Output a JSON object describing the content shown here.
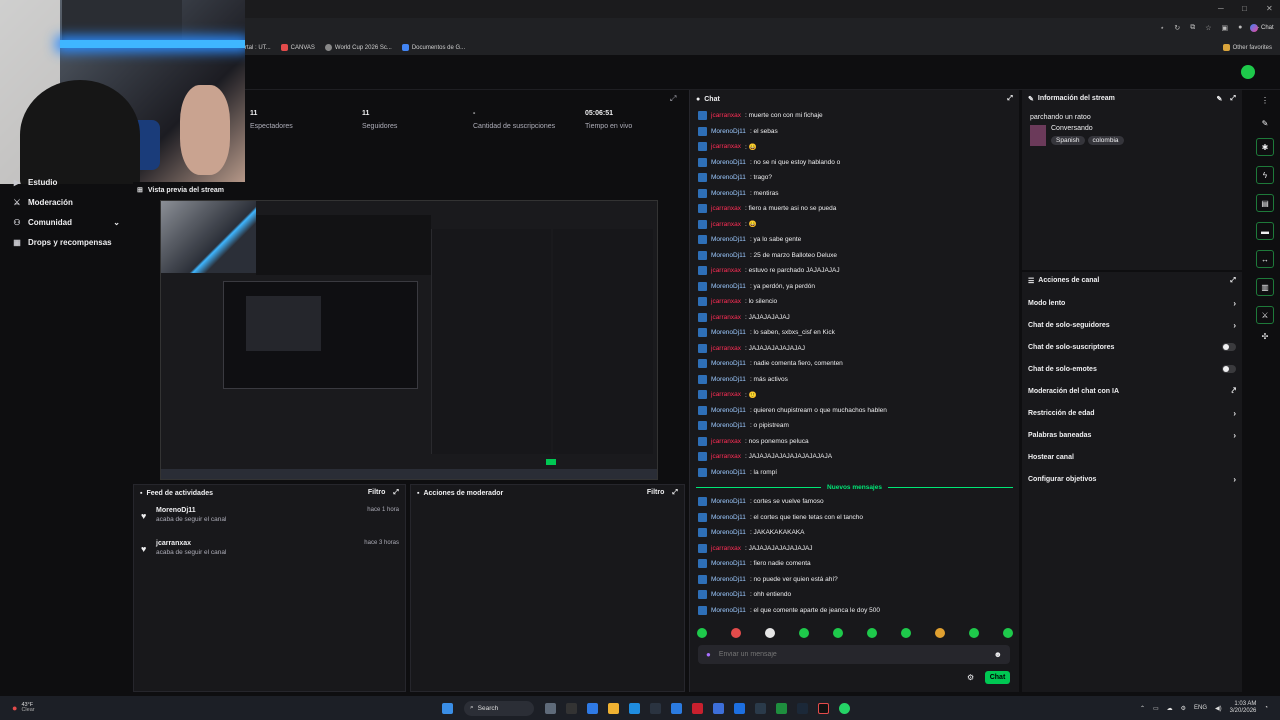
{
  "browser": {
    "bookmarks": [
      "rtal : UT...",
      "CANVAS",
      "World Cup 2026 Sc...",
      "Documentos de G..."
    ],
    "other_favorites": "Other favorites",
    "chat_tab": "Chat"
  },
  "nav": {
    "items": [
      {
        "label": "Estudio",
        "icon": "video-icon"
      },
      {
        "label": "Moderación",
        "icon": "sword-icon"
      },
      {
        "label": "Comunidad",
        "icon": "community-icon"
      },
      {
        "label": "Drops y recompensas",
        "icon": "gift-icon"
      }
    ]
  },
  "stats": [
    {
      "value": "11",
      "label": "Espectadores"
    },
    {
      "value": "11",
      "label": "Seguidores"
    },
    {
      "value": "-",
      "label": "Cantidad de suscripciones"
    },
    {
      "value": "05:06:51",
      "label": "Tiempo en vivo"
    }
  ],
  "preview": {
    "title": "Vista previa del stream"
  },
  "feed": {
    "title": "Feed de actividades",
    "filter": "Filtro",
    "items": [
      {
        "user": "MorenoDj11",
        "action": "acaba de seguir el canal",
        "time": "hace 1 hora"
      },
      {
        "user": "jcarranxax",
        "action": "acaba de seguir el canal",
        "time": "hace 3 horas"
      }
    ]
  },
  "mod_actions": {
    "title": "Acciones de moderador",
    "filter": "Filtro"
  },
  "chat": {
    "title": "Chat",
    "messages": [
      {
        "user": "jcarranxax",
        "color": "red",
        "text": ": muerte con con mi fichaje"
      },
      {
        "user": "MorenoDj11",
        "color": "blue",
        "text": ": el sebas"
      },
      {
        "user": "jcarranxax",
        "color": "red",
        "text": ": 😄"
      },
      {
        "user": "MorenoDj11",
        "color": "blue",
        "text": ": no se ni que estoy hablando o"
      },
      {
        "user": "MorenoDj11",
        "color": "blue",
        "text": ": trago?"
      },
      {
        "user": "MorenoDj11",
        "color": "blue",
        "text": ": mentiras"
      },
      {
        "user": "jcarranxax",
        "color": "red",
        "text": ": fiero a muerte asi no se pueda"
      },
      {
        "user": "jcarranxax",
        "color": "red",
        "text": ": 😄"
      },
      {
        "user": "MorenoDj11",
        "color": "blue",
        "text": ": ya lo sabe gente"
      },
      {
        "user": "MorenoDj11",
        "color": "blue",
        "text": ": 25 de marzo Balloteo Deluxe"
      },
      {
        "user": "jcarranxax",
        "color": "red",
        "text": ": estuvo re parchado JAJAJAJAJ"
      },
      {
        "user": "MorenoDj11",
        "color": "blue",
        "text": ": ya perdón, ya perdón"
      },
      {
        "user": "jcarranxax",
        "color": "red",
        "text": ": lo silencio"
      },
      {
        "user": "jcarranxax",
        "color": "red",
        "text": ": JAJAJAJAJAJ"
      },
      {
        "user": "MorenoDj11",
        "color": "blue",
        "text": ": lo saben, sxbxs_cisf en Kick"
      },
      {
        "user": "jcarranxax",
        "color": "red",
        "text": ": JAJAJAJAJAJAJAJ"
      },
      {
        "user": "MorenoDj11",
        "color": "blue",
        "text": ": nadie comenta fiero, comenten"
      },
      {
        "user": "MorenoDj11",
        "color": "blue",
        "text": ": más activos"
      },
      {
        "user": "jcarranxax",
        "color": "red",
        "text": ": 🙂"
      },
      {
        "user": "MorenoDj11",
        "color": "blue",
        "text": ": quieren chupistream o que muchachos hablen"
      },
      {
        "user": "MorenoDj11",
        "color": "blue",
        "text": ": o pipistream"
      },
      {
        "user": "jcarranxax",
        "color": "red",
        "text": ": nos ponemos peluca"
      },
      {
        "user": "jcarranxax",
        "color": "red",
        "text": ": JAJAJAJAJAJAJAJAJAJAJA"
      },
      {
        "user": "MorenoDj11",
        "color": "blue",
        "text": ": la rompí"
      }
    ],
    "new_label": "Nuevos mensajes",
    "new_messages": [
      {
        "user": "MorenoDj11",
        "color": "blue",
        "text": ": cortes se vuelve famoso"
      },
      {
        "user": "MorenoDj11",
        "color": "blue",
        "text": ": el cortes que tiene tetas con el tancho"
      },
      {
        "user": "MorenoDj11",
        "color": "blue",
        "text": ": JAKAKAKAKAKA"
      },
      {
        "user": "jcarranxax",
        "color": "red",
        "text": ": JAJAJAJAJAJAJAJAJ"
      },
      {
        "user": "MorenoDj11",
        "color": "blue",
        "text": ": fiero nadie comenta"
      },
      {
        "user": "MorenoDj11",
        "color": "blue",
        "text": ": no puede ver quien está ahí?"
      },
      {
        "user": "MorenoDj11",
        "color": "blue",
        "text": ": ohh entiendo"
      },
      {
        "user": "MorenoDj11",
        "color": "blue",
        "text": ": el que comente aparte de jeanca le doy 500"
      }
    ],
    "input_placeholder": "Enviar un mensaje",
    "send_label": "Chat"
  },
  "info": {
    "title": "Información del stream",
    "stream_title": "parchando un ratoo",
    "category": "Conversando",
    "tags": [
      "Spanish",
      "colombia"
    ]
  },
  "actions": {
    "title": "Acciones de canal",
    "items": [
      {
        "label": "Modo lento",
        "control": "chevron"
      },
      {
        "label": "Chat de solo-seguidores",
        "control": "chevron"
      },
      {
        "label": "Chat de solo-suscriptores",
        "control": "toggle"
      },
      {
        "label": "Chat de solo-emotes",
        "control": "toggle"
      },
      {
        "label": "Moderación del chat con IA",
        "control": "external"
      },
      {
        "label": "Restricción de edad",
        "control": "chevron"
      },
      {
        "label": "Palabras baneadas",
        "control": "chevron"
      },
      {
        "label": "Hostear canal",
        "control": "none"
      },
      {
        "label": "Configurar objetivos",
        "control": "chevron"
      }
    ]
  },
  "taskbar": {
    "weather_temp": "43°F",
    "weather_label": "Clear",
    "search": "Search",
    "lang": "ENG",
    "time": "1:03 AM",
    "date": "3/20/2026"
  },
  "colors": {
    "accent": "#00c853",
    "user_red": "#ff2d55",
    "user_blue": "#9cc9ff"
  }
}
